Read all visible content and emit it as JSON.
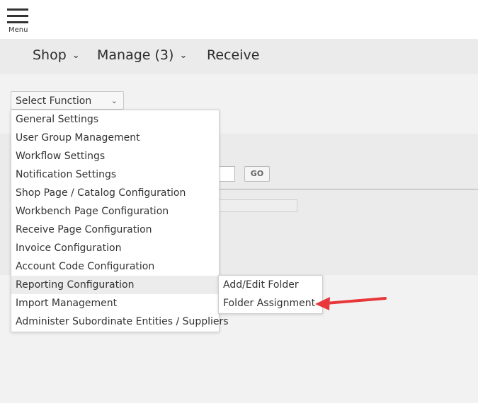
{
  "topbar": {
    "menu_label": "Menu"
  },
  "nav": {
    "shop_label": "Shop",
    "manage_label": "Manage (3)",
    "receive_label": "Receive",
    "chevron": "⌄"
  },
  "function_select": {
    "value": "Select Function",
    "chevron": "⌄"
  },
  "dropdown": {
    "items": [
      {
        "label": "General Settings"
      },
      {
        "label": "User Group Management"
      },
      {
        "label": "Workflow Settings"
      },
      {
        "label": "Notification Settings"
      },
      {
        "label": "Shop Page / Catalog Configuration"
      },
      {
        "label": "Workbench Page Configuration"
      },
      {
        "label": "Receive Page Configuration"
      },
      {
        "label": "Invoice Configuration"
      },
      {
        "label": "Account Code Configuration"
      },
      {
        "label": "Reporting Configuration"
      },
      {
        "label": "Import Management"
      },
      {
        "label": "Administer Subordinate Entities / Suppliers"
      }
    ],
    "active_item": "Reporting Configuration"
  },
  "submenu": {
    "items": [
      {
        "label": "Add/Edit Folder"
      },
      {
        "label": "Folder Assignment"
      }
    ]
  },
  "background": {
    "go_label": "GO"
  },
  "colors": {
    "annotation_arrow": "#e8373a"
  }
}
